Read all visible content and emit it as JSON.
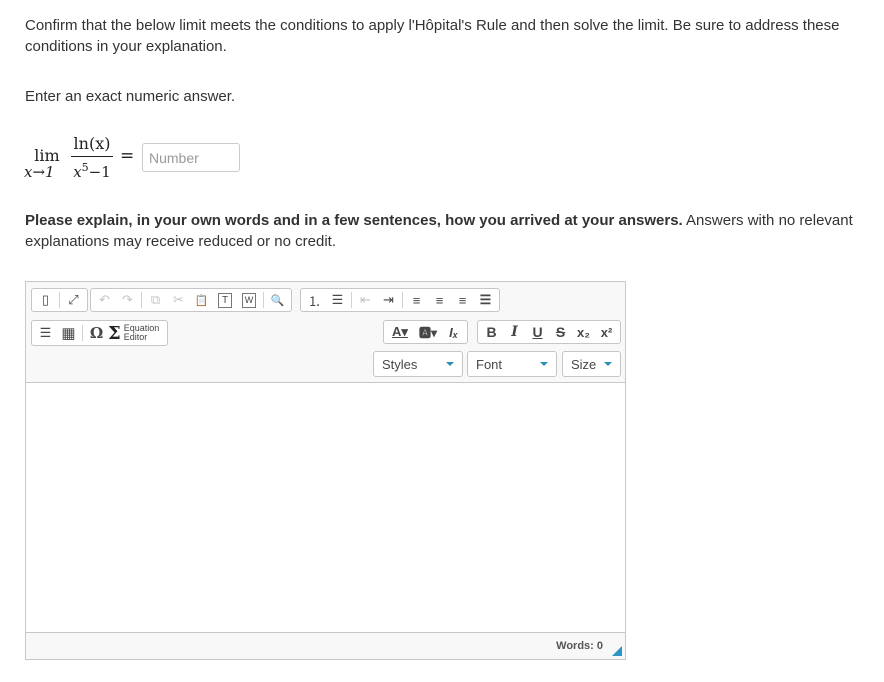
{
  "question": {
    "instruction": "Confirm that the below limit meets the conditions to apply l'Hôpital's Rule and then solve the limit. Be sure to address these conditions in your explanation.",
    "answer_prompt": "Enter an exact numeric answer.",
    "limit": {
      "operator": "lim",
      "approach": "x→1",
      "numerator": "ln(x)",
      "denominator_base": "x",
      "denominator_exponent": "5",
      "denominator_rest": "−1",
      "equals": "="
    },
    "answer_input": {
      "value": "",
      "placeholder": "Number"
    },
    "explain_bold": "Please explain, in your own words and in a few sentences, how you arrived at your answers.",
    "explain_rest": " Answers with no relevant explanations may receive reduced or no credit."
  },
  "editor": {
    "toolbar_row1_groupA": [
      {
        "icon": "show-blocks-icon",
        "glyph": "▯"
      },
      {
        "icon": "maximize-icon",
        "glyph": "⤢"
      }
    ],
    "toolbar_row1_groupB": [
      {
        "icon": "undo-icon",
        "glyph": "↶",
        "disabled": true
      },
      {
        "icon": "redo-icon",
        "glyph": "↷",
        "disabled": true
      },
      {
        "icon": "copy-icon",
        "glyph": "⧉",
        "disabled": true
      },
      {
        "icon": "cut-icon",
        "glyph": "✂",
        "disabled": true
      },
      {
        "icon": "paste-icon",
        "glyph": "📋"
      },
      {
        "icon": "paste-text-icon",
        "glyph": "T"
      },
      {
        "icon": "paste-word-icon",
        "glyph": "W"
      },
      {
        "icon": "find-icon",
        "glyph": "🔍"
      }
    ],
    "toolbar_row1_groupC": [
      {
        "icon": "numbered-list-icon",
        "glyph": "⒈"
      },
      {
        "icon": "bulleted-list-icon",
        "glyph": "☰"
      },
      {
        "icon": "decrease-indent-icon",
        "glyph": "⇤",
        "disabled": true
      },
      {
        "icon": "increase-indent-icon",
        "glyph": "⇥"
      },
      {
        "icon": "align-left-icon",
        "glyph": "≡"
      },
      {
        "icon": "align-center-icon",
        "glyph": "≡"
      },
      {
        "icon": "align-right-icon",
        "glyph": "≡"
      },
      {
        "icon": "justify-icon",
        "glyph": "☰"
      }
    ],
    "toolbar_row2_groupA": [
      {
        "icon": "horizontal-line-icon",
        "glyph": "☰"
      },
      {
        "icon": "table-icon",
        "glyph": "▦"
      },
      {
        "icon": "special-char-icon",
        "glyph": "Ω"
      },
      {
        "icon": "equation-editor-icon",
        "glyph": "Σ"
      }
    ],
    "equation_editor_label_1": "Equation",
    "equation_editor_label_2": "Editor",
    "toolbar_row2_groupB": [
      {
        "icon": "text-color-icon",
        "glyph": "A▾"
      },
      {
        "icon": "background-color-icon",
        "glyph": "🅰▾"
      },
      {
        "icon": "remove-format-icon",
        "glyph": "Iₓ"
      }
    ],
    "toolbar_row2_groupC": [
      {
        "icon": "bold-icon",
        "glyph": "B"
      },
      {
        "icon": "italic-icon",
        "glyph": "I"
      },
      {
        "icon": "underline-icon",
        "glyph": "U"
      },
      {
        "icon": "strikethrough-icon",
        "glyph": "S"
      },
      {
        "icon": "subscript-icon",
        "glyph": "x₂"
      },
      {
        "icon": "superscript-icon",
        "glyph": "x²"
      }
    ],
    "dropdowns": {
      "styles": "Styles",
      "font": "Font",
      "size": "Size"
    },
    "content": "",
    "word_count": "Words: 0",
    "accent_color": "#2b95c6"
  }
}
